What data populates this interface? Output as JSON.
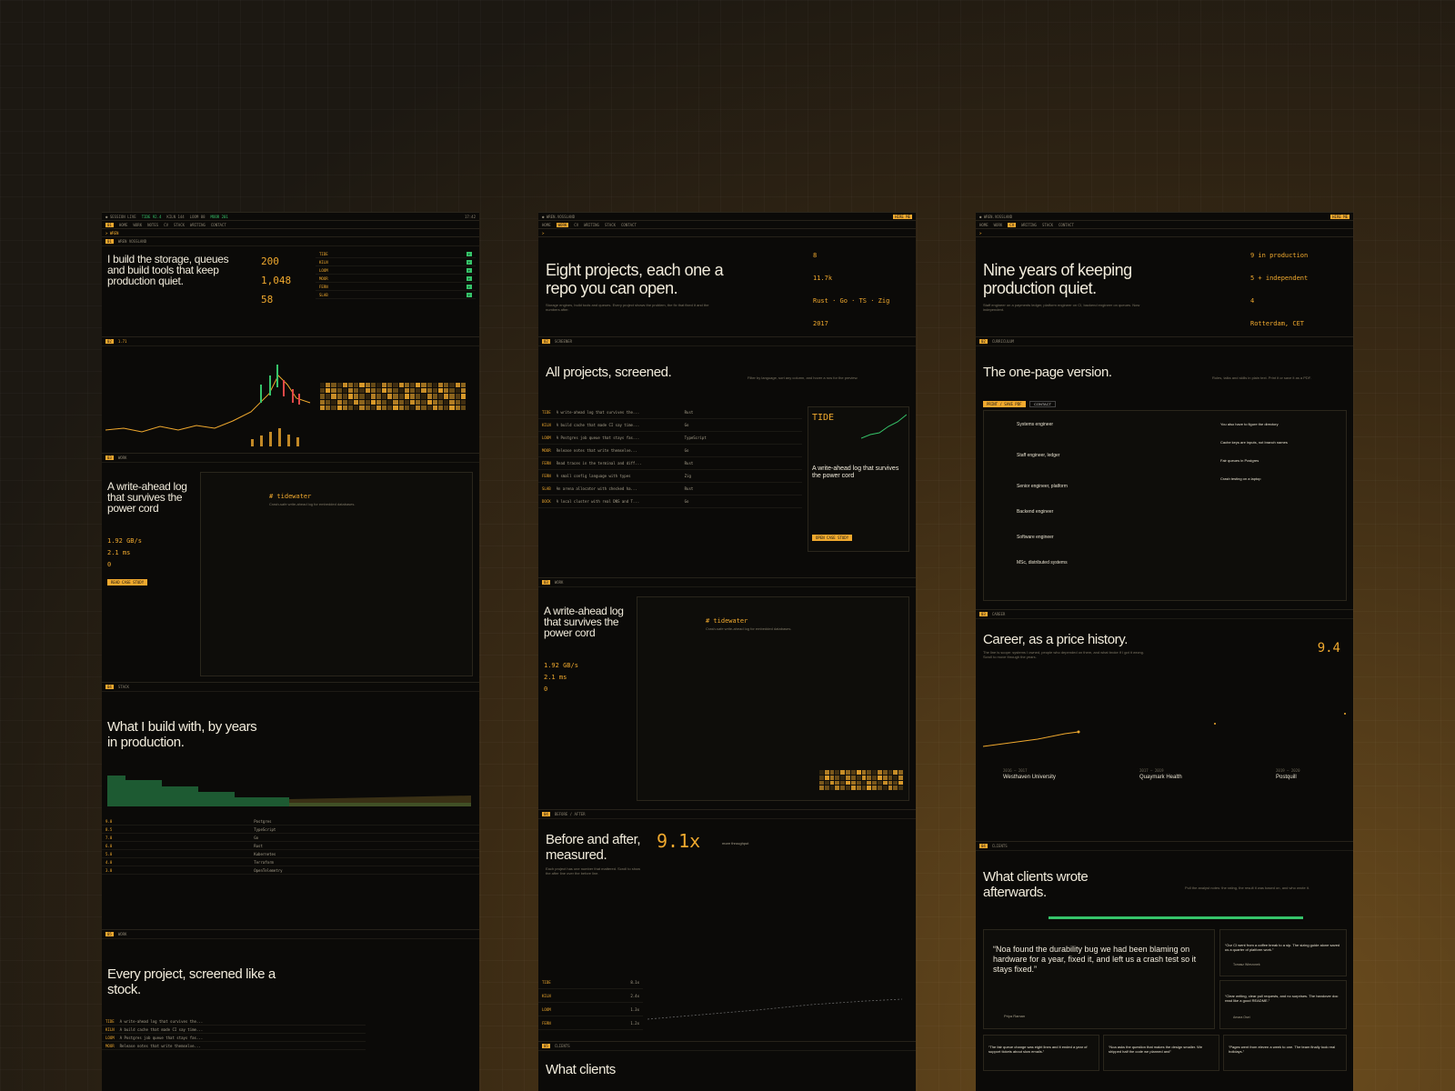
{
  "panel1": {
    "hero_title": "I build the storage, queues and build tools that keep production quiet.",
    "stat_1": "200",
    "stat_2": "1,048",
    "stat_3": "58",
    "ticker_main": "1.71",
    "project_title": "A write-ahead log that survives the power cord",
    "throughput": "1.92 GB/s",
    "latency": "2.1 ms",
    "zero": "0",
    "btn_case": "READ CASE STUDY",
    "readme_title": "# tidewater",
    "readme_sub": "Crash-safe write-ahead log for embedded databases.",
    "stack_title": "What I build with, by years in production.",
    "stack_rows": [
      {
        "years": "9.0",
        "lang": "Postgres"
      },
      {
        "years": "8.5",
        "lang": "TypeScript"
      },
      {
        "years": "7.0",
        "lang": "Go"
      },
      {
        "years": "6.0",
        "lang": "Rust"
      },
      {
        "years": "5.0",
        "lang": "Kubernetes"
      },
      {
        "years": "4.0",
        "lang": "Terraform"
      },
      {
        "years": "3.0",
        "lang": "OpenTelemetry"
      }
    ],
    "stock_title": "Every project, screened like a stock.",
    "stock_rows": [
      {
        "ticker": "TIDE",
        "name": "A write-ahead log that survives the..."
      },
      {
        "ticker": "KILN",
        "name": "A build cache that made CI say time..."
      },
      {
        "ticker": "LOOM",
        "name": "A Postgres job queue that stays fas..."
      },
      {
        "ticker": "MOOR",
        "name": "Release notes that write themselve..."
      }
    ]
  },
  "panel2": {
    "hero_title": "Eight projects, each one a repo you can open.",
    "hero_sub": "Storage engines, build tools and queues. Every project shows the problem, the fix that fixed it and the numbers after.",
    "projects_val": "8",
    "stars_val": "11.7k",
    "langs_val": "Rust · Go · TS · Zig",
    "since_val": "2017",
    "screen_title": "All projects, screened.",
    "screen_sub": "Filter by language, sort any column, and hover a row for the preview.",
    "rows": [
      {
        "ticker": "TIDE",
        "name": "A write-ahead log that survives the...",
        "lang": "Rust"
      },
      {
        "ticker": "KILN",
        "name": "A build cache that made CI say time...",
        "lang": "Go"
      },
      {
        "ticker": "LOOM",
        "name": "A Postgres job queue that stays fas...",
        "lang": "TypeScript"
      },
      {
        "ticker": "MOOR",
        "name": "Release notes that write themselve...",
        "lang": "Go"
      },
      {
        "ticker": "FERN",
        "name": "Read traces in the terminal and diff...",
        "lang": "Rust"
      },
      {
        "ticker": "FERN",
        "name": "A small config language with types",
        "lang": "Zig"
      },
      {
        "ticker": "SLAB",
        "name": "An arena allocator with checked ha...",
        "lang": "Rust"
      },
      {
        "ticker": "DOCK",
        "name": "A local cluster with real DNS and T...",
        "lang": "Go"
      }
    ],
    "preview_title": "A write-ahead log that survives the power cord",
    "preview_ticker": "TIDE",
    "btn_case": "OPEN CASE STUDY",
    "project_title": "A write-ahead log that survives the power cord",
    "throughput": "1.92 GB/s",
    "latency": "2.1 ms",
    "zero": "0",
    "readme_title": "# tidewater",
    "readme_sub": "Crash-safe write-ahead log for embedded databases.",
    "ba_title": "Before and after, measured.",
    "ba_sub": "Each project has one number that mattered. Scroll to show the after line over the before line.",
    "ba_big": "9.1x",
    "ba_unit": "more throughput",
    "ba_rows": [
      {
        "ticker": "TIDE",
        "val": "8.1x"
      },
      {
        "ticker": "KILN",
        "val": "2.4x"
      },
      {
        "ticker": "LOOM",
        "val": "1.3x"
      },
      {
        "ticker": "FERN",
        "val": "1.2x"
      }
    ],
    "clients_title": "What clients"
  },
  "panel3": {
    "hero_title": "Nine years of keeping production quiet.",
    "hero_sub": "Staff engineer on a payments ledger, platform engineer on CI, backend engineer on queues. Now independent.",
    "years_val": "9 in production",
    "roles_val": "5 + independent",
    "oss_val": "4",
    "based_val": "Rotterdam, CET",
    "onepage_title": "The one-page version.",
    "onepage_sub": "Roles, talks and skills in plain text. Print it or save it as a PDF.",
    "btn_print": "PRINT / SAVE PDF",
    "btn_contact": "CONTACT",
    "roles": [
      "Systems engineer",
      "Staff engineer, ledger",
      "Senior engineer, platform",
      "Backend engineer",
      "Software engineer",
      "MSc, distributed systems"
    ],
    "talks": [
      "You also have to figure the directory",
      "Cache keys are inputs, not branch names",
      "Fair queues in Postgres",
      "Crash testing on a laptop"
    ],
    "career_title": "Career, as a price history.",
    "career_sub": "The line is scope: systems I owned, people who depended on them, and what broke if I got it wrong. Scroll to move through the years.",
    "career_val": "9.4",
    "jobs": [
      {
        "years": "2016 – 2017",
        "name": "Westhaven University"
      },
      {
        "years": "2017 – 2019",
        "name": "Quaymark Health"
      },
      {
        "years": "2019 – 2020",
        "name": "Postquill"
      }
    ],
    "clients_title": "What clients wrote afterwards.",
    "clients_sub": "Pull the analyst notes: the rating, the result it was based on, and who wrote it.",
    "quote_main": "“Noa found the durability bug we had been blaming on hardware for a year, fixed it, and left us a crash test so it stays fixed.”",
    "quote_author": "Priya Raman",
    "quote_2": "“Our CI went from a coffee break to a sip. The sizing guide alone saved us a quarter of platform work.”",
    "quote_2_author": "Tomasz Wierzonek",
    "quote_3": "“Clear writing, clear pull requests, and no surprises. The handover doc read like a good README.”",
    "quote_3_author": "Amara Osei",
    "quote_4": "“The fair queue change was eight lines and it ended a year of support tickets about slow emails.”",
    "quote_5": "“Noa asks the question that makes the design smaller. We shipped half the code we planned and”",
    "quote_6": "“Pages went from eleven a week to one. The team finally took real holidays.”"
  }
}
